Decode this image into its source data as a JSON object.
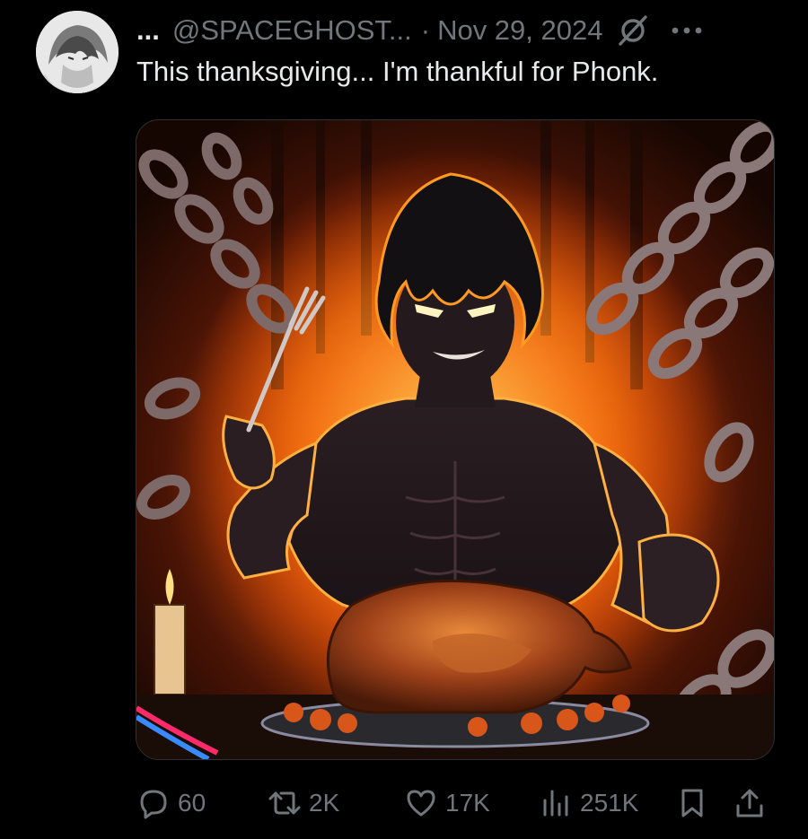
{
  "author": {
    "display_name": "...",
    "handle": "@SPACEGHOST...",
    "separator": "·",
    "date": "Nov 29, 2024",
    "avatar": "avatar-image"
  },
  "tweet": {
    "text": "This thanksgiving... I'm thankful for Phonk."
  },
  "media": {
    "image": "anime-figure-flames-chains-turkey-image"
  },
  "actions": {
    "replies": "60",
    "retweets": "2K",
    "likes": "17K",
    "views": "251K"
  },
  "icons": {
    "grok": "grok-icon",
    "more": "more-icon",
    "reply": "reply-icon",
    "retweet": "retweet-icon",
    "like": "heart-icon",
    "views": "views-icon",
    "bookmark": "bookmark-icon",
    "share": "share-icon"
  },
  "colors": {
    "background": "#000000",
    "text_primary": "#e7e9ea",
    "text_secondary": "#71767b",
    "fire": "#ff8c1a"
  }
}
